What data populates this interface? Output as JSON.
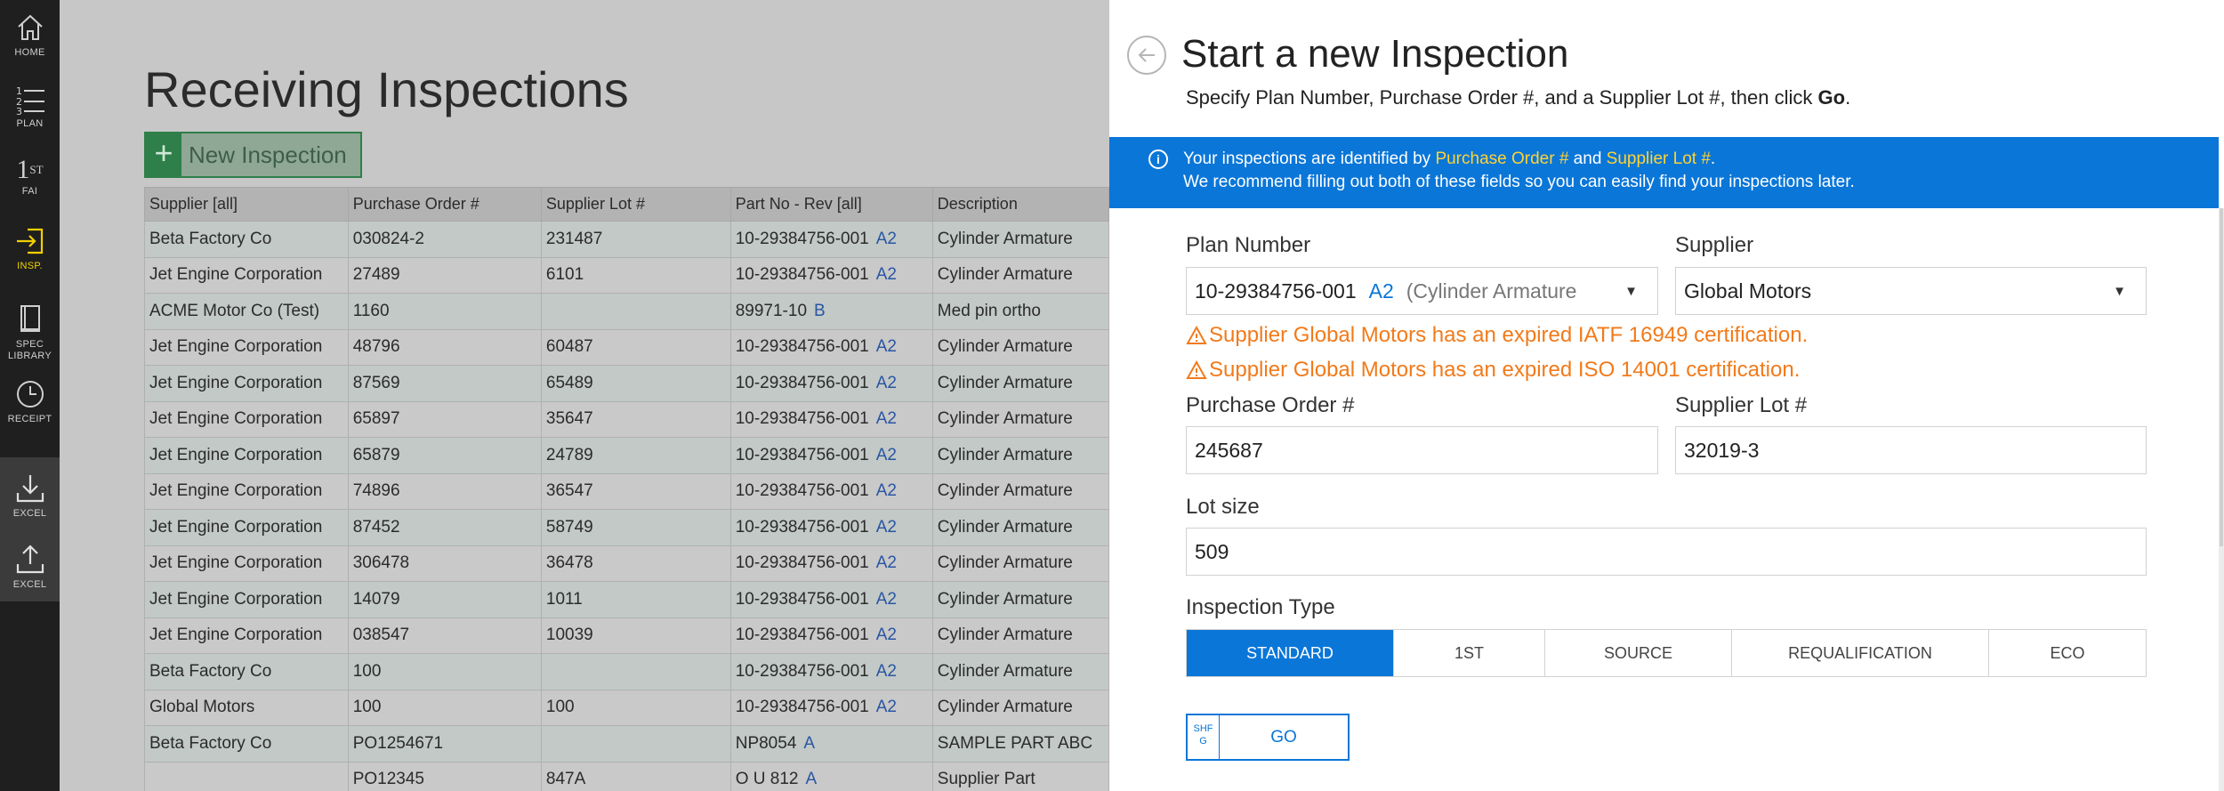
{
  "nav": {
    "home": "HOME",
    "plan": "PLAN",
    "fai_big": "1",
    "fai_sup": "ST",
    "fai": "FAI",
    "insp": "INSP.",
    "spec": "SPEC\nLIBRARY",
    "receipt": "RECEIPT",
    "excel_down": "EXCEL",
    "excel_up": "EXCEL",
    "active_color": "#f0d000"
  },
  "background": {
    "title": "Receiving Inspections",
    "new_button": "New Inspection",
    "columns": [
      "Supplier [all]",
      "Purchase Order #",
      "Supplier Lot #",
      "Part No - Rev [all]",
      "Description"
    ],
    "rows": [
      {
        "supplier": "Beta Factory Co",
        "po": "030824-2",
        "lot": "231487",
        "part": "10-29384756-001",
        "rev": "A2",
        "desc": "Cylinder Armature"
      },
      {
        "supplier": "Jet Engine Corporation",
        "po": "27489",
        "lot": "6101",
        "part": "10-29384756-001",
        "rev": "A2",
        "desc": "Cylinder Armature"
      },
      {
        "supplier": "ACME Motor Co (Test)",
        "po": "1160",
        "lot": "",
        "part": "89971-10",
        "rev": "B",
        "desc": "Med pin ortho"
      },
      {
        "supplier": "Jet Engine Corporation",
        "po": "48796",
        "lot": "60487",
        "part": "10-29384756-001",
        "rev": "A2",
        "desc": "Cylinder Armature"
      },
      {
        "supplier": "Jet Engine Corporation",
        "po": "87569",
        "lot": "65489",
        "part": "10-29384756-001",
        "rev": "A2",
        "desc": "Cylinder Armature"
      },
      {
        "supplier": "Jet Engine Corporation",
        "po": "65897",
        "lot": "35647",
        "part": "10-29384756-001",
        "rev": "A2",
        "desc": "Cylinder Armature"
      },
      {
        "supplier": "Jet Engine Corporation",
        "po": "65879",
        "lot": "24789",
        "part": "10-29384756-001",
        "rev": "A2",
        "desc": "Cylinder Armature"
      },
      {
        "supplier": "Jet Engine Corporation",
        "po": "74896",
        "lot": "36547",
        "part": "10-29384756-001",
        "rev": "A2",
        "desc": "Cylinder Armature"
      },
      {
        "supplier": "Jet Engine Corporation",
        "po": "87452",
        "lot": "58749",
        "part": "10-29384756-001",
        "rev": "A2",
        "desc": "Cylinder Armature"
      },
      {
        "supplier": "Jet Engine Corporation",
        "po": "306478",
        "lot": "36478",
        "part": "10-29384756-001",
        "rev": "A2",
        "desc": "Cylinder Armature"
      },
      {
        "supplier": "Jet Engine Corporation",
        "po": "14079",
        "lot": "1011",
        "part": "10-29384756-001",
        "rev": "A2",
        "desc": "Cylinder Armature"
      },
      {
        "supplier": "Jet Engine Corporation",
        "po": "038547",
        "lot": "10039",
        "part": "10-29384756-001",
        "rev": "A2",
        "desc": "Cylinder Armature"
      },
      {
        "supplier": "Beta Factory Co",
        "po": "100",
        "lot": "",
        "part": "10-29384756-001",
        "rev": "A2",
        "desc": "Cylinder Armature"
      },
      {
        "supplier": "Global Motors",
        "po": "100",
        "lot": "100",
        "part": "10-29384756-001",
        "rev": "A2",
        "desc": "Cylinder Armature"
      },
      {
        "supplier": "Beta Factory Co",
        "po": "PO1254671",
        "lot": "",
        "part": "NP8054",
        "rev": "A",
        "desc": "SAMPLE PART ABC"
      },
      {
        "supplier": "",
        "po": "PO12345",
        "lot": "847A",
        "part": "O U 812",
        "rev": "A",
        "desc": "Supplier Part"
      }
    ]
  },
  "drawer": {
    "title": "Start a new Inspection",
    "subtitle_pre": "Specify Plan Number, Purchase Order #, and a Supplier Lot #, then click ",
    "subtitle_bold": "Go",
    "subtitle_post": ".",
    "info": {
      "icon": "info-icon",
      "line1_pre": "Your inspections are identified by ",
      "line1_po": "Purchase Order #",
      "line1_and": " and ",
      "line1_lot": "Supplier Lot #",
      "line1_post": ".",
      "line2": "We recommend filling out both of these fields so you can easily find your inspections later."
    },
    "plan_label": "Plan Number",
    "plan_number": "10-29384756-001",
    "plan_rev": "A2",
    "plan_desc": "(Cylinder Armature",
    "supplier_label": "Supplier",
    "supplier_value": "Global Motors",
    "warnings": [
      "Supplier Global Motors has an expired IATF 16949 certification.",
      "Supplier Global Motors has an expired ISO 14001 certification."
    ],
    "po_label": "Purchase Order #",
    "po_value": "245687",
    "lot_label": "Supplier Lot #",
    "lot_value": "32019-3",
    "lot_size_label": "Lot size",
    "lot_size_value": "509",
    "type_label": "Inspection Type",
    "types": [
      "STANDARD",
      "1ST",
      "SOURCE",
      "REQUALIFICATION",
      "ECO"
    ],
    "selected_type": "STANDARD",
    "go_shortcut": "SHF\nG",
    "go_label": "GO",
    "accent_color": "#0a76d8",
    "warning_color": "#f27a1a"
  }
}
